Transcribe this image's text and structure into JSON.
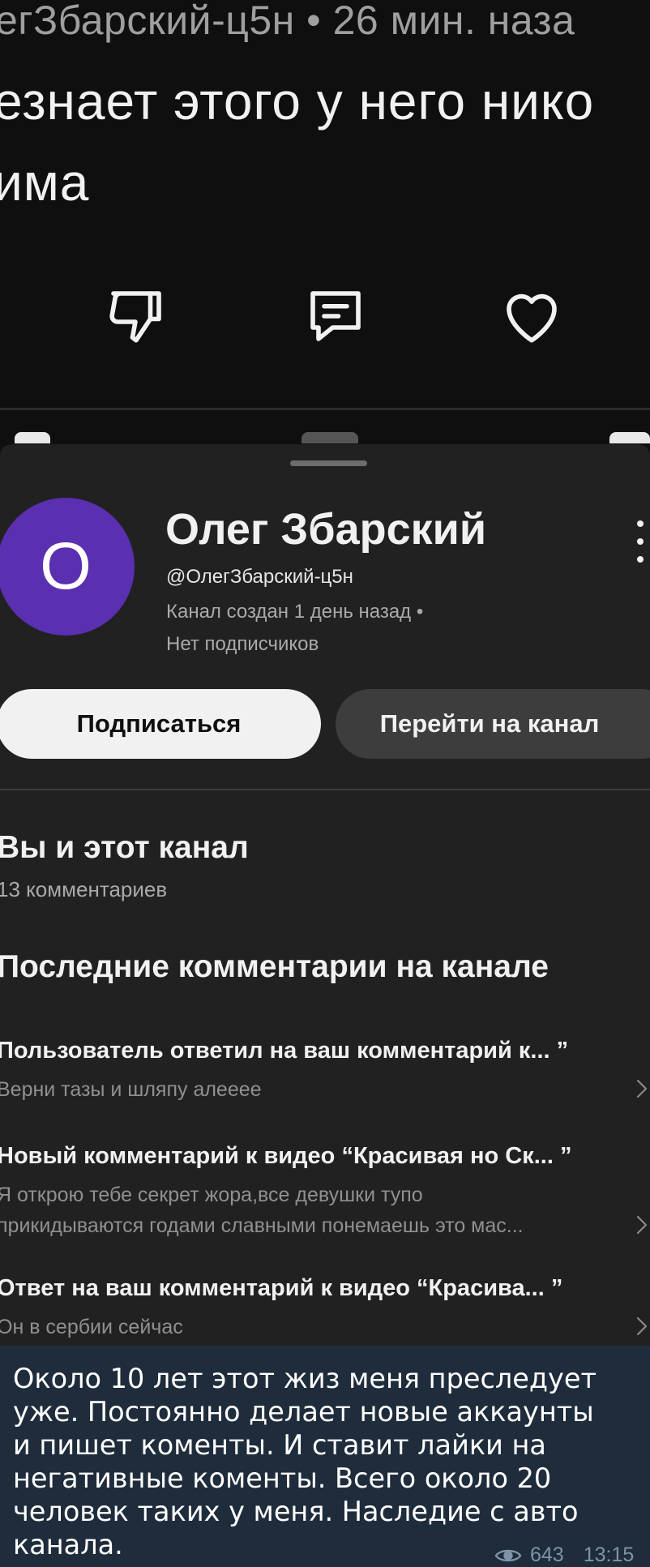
{
  "comment": {
    "meta": "егЗбарский-ц5н • 26 мин. наза",
    "text_line1": "езнает этого у него нико",
    "text_line2": "има"
  },
  "sheet": {
    "avatar_letter": "О",
    "channel_name": "Олег Збарский",
    "handle": "@ОлегЗбарский-ц5н",
    "info_line1": "Канал создан 1 день назад •",
    "info_line2": "Нет подписчиков",
    "subscribe_label": "Подписаться",
    "goto_label": "Перейти на канал",
    "you_and_channel_title": "Вы и этот канал",
    "comments_count": "13 комментариев",
    "recent_title": "Последние комментарии на канале",
    "notifications": [
      {
        "title": "Пользователь ответил на ваш комментарий к... ”",
        "body_lines": [
          "Верни тазы и шляпу алееее"
        ]
      },
      {
        "title": "Новый комментарий к видео “Красивая но Ск... ”",
        "body_lines": [
          "Я открою тебе секрет жора,все девушки  тупо",
          "прикидываются годами славными понемаешь это мас..."
        ]
      },
      {
        "title": "Ответ на ваш комментарий к видео “Красива... ”",
        "body_lines": [
          "Он в сербии сейчас"
        ]
      }
    ]
  },
  "message": {
    "lines": [
      "Около 10 лет этот жиз меня преследует",
      "уже. Постоянно делает новые аккаунты",
      "и пишет коменты. И ставит лайки на",
      "негативные коменты. Всего около 20",
      "человек таких у меня. Наследие с авто",
      "канала."
    ],
    "views": "643",
    "time": "13:15"
  },
  "colors": {
    "avatar": "#5a2fb0",
    "sheet_bg": "#212121",
    "bubble_bg": "#1f2c3b"
  },
  "icons": [
    "dislike-icon",
    "reply-icon",
    "like-icon",
    "more-vert-icon",
    "chevron-right-icon",
    "eye-icon"
  ]
}
